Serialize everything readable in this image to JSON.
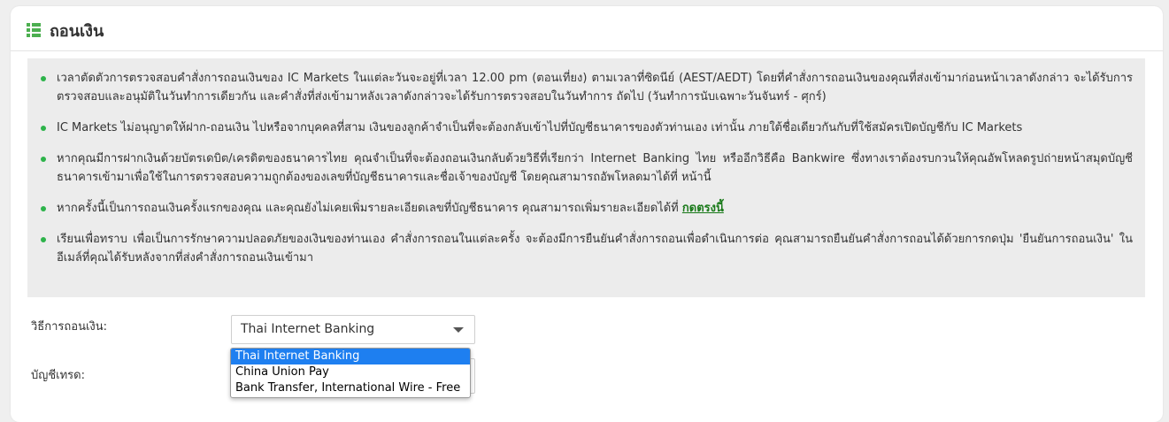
{
  "header": {
    "title": "ถอนเงิน",
    "icon": "list-icon"
  },
  "notice": {
    "items": [
      {
        "text": "เวลาตัดตัวการตรวจสอบคำสั่งการถอนเงินของ IC Markets ในแต่ละวันจะอยู่ที่เวลา 12.00 pm (ตอนเที่ยง) ตามเวลาที่ซิดนีย์ (AEST/AEDT) โดยที่คำสั่งการถอนเงินของคุณที่ส่งเข้ามาก่อนหน้าเวลาดังกล่าว จะได้รับการตรวจสอบและอนุมัติในวันทำการเดียวกัน และคำสั่งที่ส่งเข้ามาหลังเวลาดังกล่าวจะได้รับการตรวจสอบในวันทำการ ถัดไป (วันทำการนับเฉพาะวันจันทร์ - ศุกร์)"
      },
      {
        "text": "IC Markets ไม่อนุญาตให้ฝาก-ถอนเงิน ไปหรือจากบุคคลที่สาม เงินของลูกค้าจำเป็นที่จะต้องกลับเข้าไปที่บัญชีธนาคารของตัวท่านเอง เท่านั้น ภายใต้ชื่อเดียวกันกับที่ใช้สมัครเปิดบัญชีกับ IC Markets"
      },
      {
        "text": "หากคุณมีการฝากเงินด้วยบัตรเดบิต/เครดิตของธนาคารไทย คุณจำเป็นที่จะต้องถอนเงินกลับด้วยวิธีที่เรียกว่า Internet Banking ไทย หรืออีกวิธีคือ Bankwire ซึ่งทางเราต้องรบกวนให้คุณอัพโหลดรูปถ่ายหน้าสมุดบัญชีธนาคารเข้ามาเพื่อใช้ในการตรวจสอบความถูกต้องของเลขที่บัญชีธนาคารและชื่อเจ้าของบัญชี โดยคุณสามารถอัพโหลดมาได้ที่ หน้านี้"
      },
      {
        "text": "หากครั้งนี้เป็นการถอนเงินครั้งแรกของคุณ และคุณยังไม่เคยเพิ่มรายละเอียดเลขที่บัญชีธนาคาร คุณสามารถเพิ่มรายละเอียดได้ที่ ",
        "link": "กดตรงนี้"
      },
      {
        "text": "เรียนเพื่อทราบ เพื่อเป็นการรักษาความปลอดภัยของเงินของท่านเอง คำสั่งการถอนในแต่ละครั้ง จะต้องมีการยืนยันคำสั่งการถอนเพื่อดำเนินการต่อ คุณสามารถยืนยันคำสั่งการถอนได้ด้วยการกดปุ่ม 'ยืนยันการถอนเงิน' ในอีเมล์ที่คุณได้รับหลังจากที่ส่งคำสั่งการถอนเงินเข้ามา"
      }
    ],
    "bullet_color": "#2db34a"
  },
  "form": {
    "method_label": "วิธีการถอนเงิน:",
    "method_value": "Thai Internet Banking",
    "account_label": "บัญชีเทรด:",
    "dropdown_options": [
      "Thai Internet Banking",
      "China Union Pay",
      "Bank Transfer, International Wire - Free"
    ],
    "selected_index": 0
  },
  "colors": {
    "accent": "#4caf50",
    "highlight": "#1e7ff0",
    "link": "#1a7a1a"
  }
}
